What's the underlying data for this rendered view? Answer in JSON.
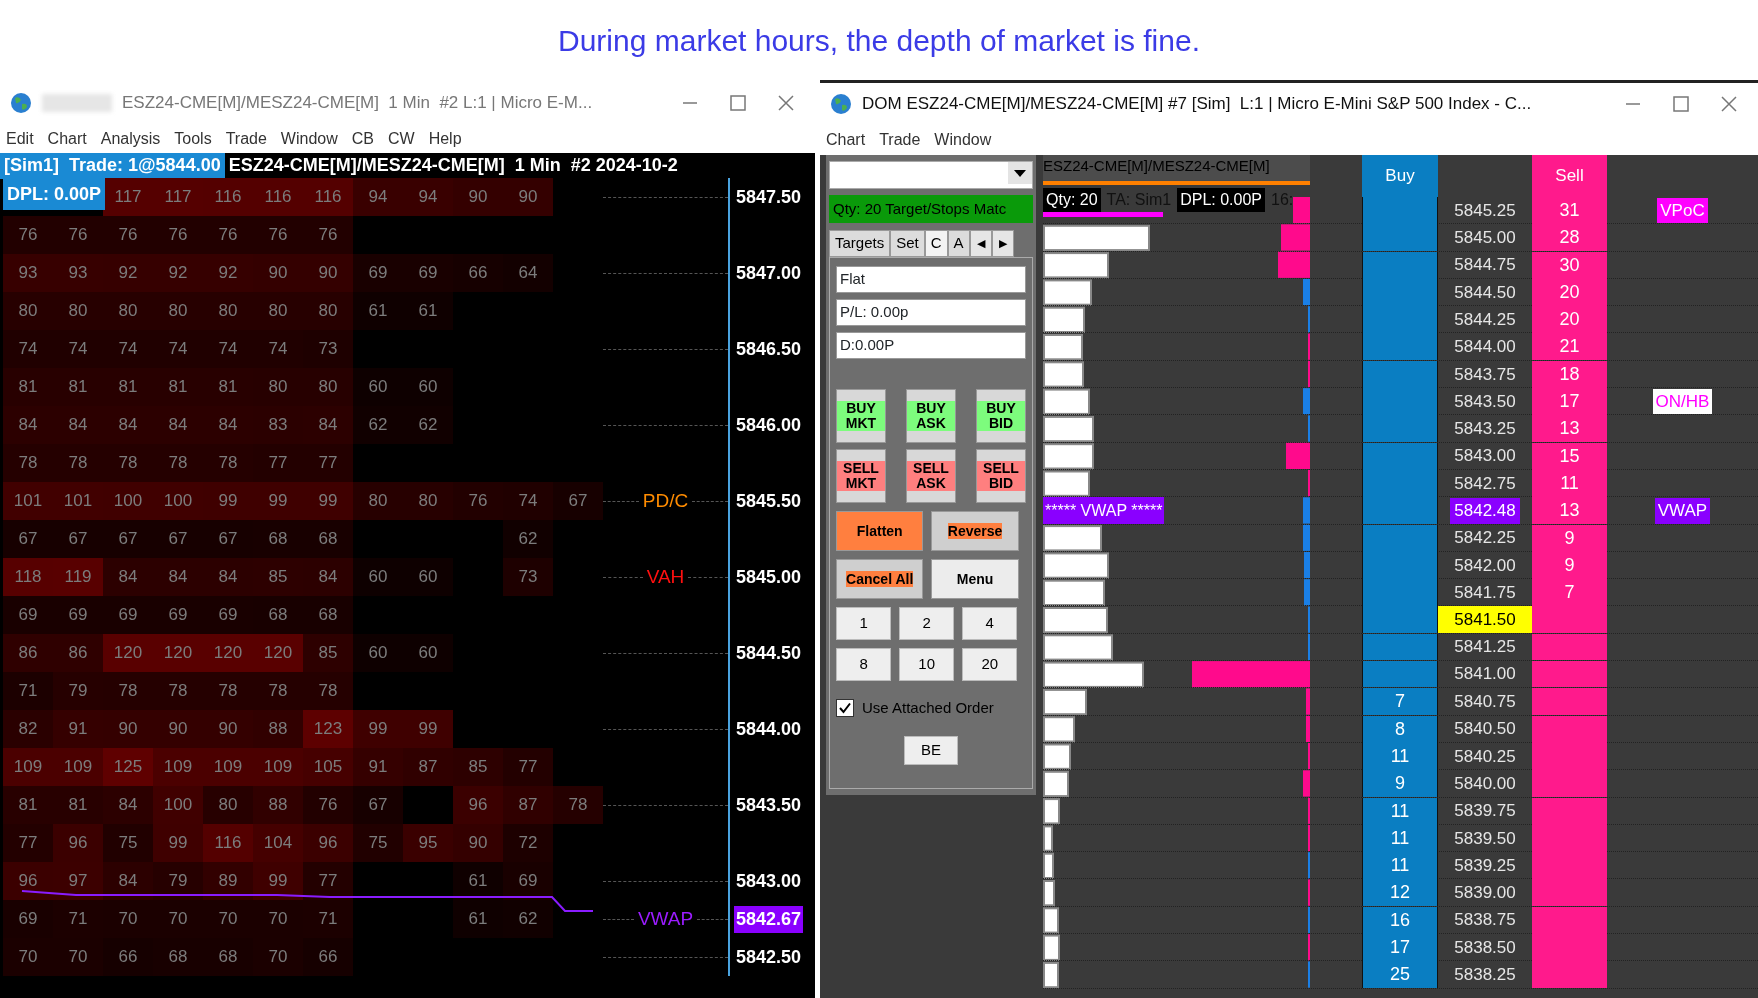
{
  "caption": "During market hours, the depth of market is fine.",
  "chart_window": {
    "title": "ESZ24-CME[M]/MESZ24-CME[M]  1 Min  #2 L:1 | Micro E-M...",
    "menu": [
      "Edit",
      "Chart",
      "Analysis",
      "Tools",
      "Trade",
      "Window",
      "CB",
      "CW",
      "Help"
    ],
    "header": {
      "account": "[Sim1]  Trade: 1@5844.00",
      "instrument": "ESZ24-CME[M]/MESZ24-CME[M]  1 Min  #2 2024-10-2",
      "dpl": "DPL: 0.00P"
    },
    "rows": [
      {
        "cells": [
          null,
          null,
          "117",
          "117",
          "116",
          "116",
          "116",
          "94",
          "94",
          "90",
          "90"
        ],
        "axis": {
          "text": "5847.50",
          "kind": "tick"
        }
      },
      {
        "cells": [
          "76",
          "76",
          "76",
          "76",
          "76",
          "76",
          "76"
        ]
      },
      {
        "cells": [
          "93",
          "93",
          "92",
          "92",
          "92",
          "90",
          "90",
          "69",
          "69",
          "66",
          "64"
        ],
        "axis": {
          "text": "5847.00",
          "kind": "tick"
        }
      },
      {
        "cells": [
          "80",
          "80",
          "80",
          "80",
          "80",
          "80",
          "80",
          "61",
          "61"
        ]
      },
      {
        "cells": [
          "74",
          "74",
          "74",
          "74",
          "74",
          "74",
          "73"
        ],
        "axis": {
          "text": "5846.50",
          "kind": "tick"
        }
      },
      {
        "cells": [
          "81",
          "81",
          "81",
          "81",
          "81",
          "80",
          "80",
          "60",
          "60"
        ]
      },
      {
        "cells": [
          "84",
          "84",
          "84",
          "84",
          "84",
          "83",
          "84",
          "62",
          "62"
        ],
        "axis": {
          "text": "5846.00",
          "kind": "tick"
        }
      },
      {
        "cells": [
          "78",
          "78",
          "78",
          "78",
          "78",
          "77",
          "77"
        ]
      },
      {
        "cells": [
          "101",
          "101",
          "100",
          "100",
          "99",
          "99",
          "99",
          "80",
          "80",
          "76",
          "74",
          "67"
        ],
        "axis": {
          "text": "5845.50",
          "kind": "tick"
        },
        "label": {
          "text": "PD/C",
          "color": "#ff8c00"
        }
      },
      {
        "cells": [
          "67",
          "67",
          "67",
          "67",
          "67",
          "68",
          "68",
          null,
          null,
          null,
          "62"
        ]
      },
      {
        "cells": [
          "118",
          "119",
          "84",
          "84",
          "84",
          "85",
          "84",
          "60",
          "60",
          null,
          "73"
        ],
        "axis": {
          "text": "5845.00",
          "kind": "tick"
        },
        "label": {
          "text": "VAH",
          "color": "#ff1010"
        }
      },
      {
        "cells": [
          "69",
          "69",
          "69",
          "69",
          "69",
          "68",
          "68"
        ]
      },
      {
        "cells": [
          "86",
          "86",
          "120",
          "120",
          "120",
          "120",
          "85",
          "60",
          "60"
        ],
        "axis": {
          "text": "5844.50",
          "kind": "tick"
        }
      },
      {
        "cells": [
          "71",
          "79",
          "78",
          "78",
          "78",
          "78",
          "78"
        ]
      },
      {
        "cells": [
          "82",
          "91",
          "90",
          "90",
          "90",
          "88",
          "123",
          "99",
          "99"
        ],
        "axis": {
          "text": "5844.00",
          "kind": "tick"
        }
      },
      {
        "cells": [
          "109",
          "109",
          "125",
          "109",
          "109",
          "109",
          "105",
          "91",
          "87",
          "85",
          "77"
        ]
      },
      {
        "cells": [
          "81",
          "81",
          "84",
          "100",
          "80",
          "88",
          "76",
          "67",
          null,
          "96",
          "87",
          "78"
        ],
        "axis": {
          "text": "5843.50",
          "kind": "tick"
        }
      },
      {
        "cells": [
          "77",
          "96",
          "75",
          "99",
          "116",
          "104",
          "96",
          "75",
          "95",
          "90",
          "72"
        ]
      },
      {
        "cells": [
          "96",
          "97",
          "84",
          "79",
          "89",
          "99",
          "77",
          null,
          null,
          "61",
          "69"
        ],
        "axis": {
          "text": "5843.00",
          "kind": "tick"
        }
      },
      {
        "cells": [
          "69",
          "71",
          "70",
          "70",
          "70",
          "70",
          "71",
          null,
          null,
          "61",
          "62"
        ],
        "axis": {
          "text": "5842.67",
          "kind": "vwap"
        },
        "label": {
          "text": "VWAP",
          "color": "#9b1cff"
        }
      },
      {
        "cells": [
          "70",
          "70",
          "66",
          "68",
          "68",
          "70",
          "66"
        ],
        "axis": {
          "text": "5842.50",
          "kind": "tick"
        }
      }
    ]
  },
  "dom_window": {
    "title": "DOM ESZ24-CME[M]/MESZ24-CME[M] #7 [Sim]  L:1 | Micro E-Mini S&P 500 Index - C...",
    "menu": [
      "Chart",
      "Trade",
      "Window"
    ],
    "panel": {
      "status": "Qty: 20 Target/Stops Matc",
      "tabs": [
        {
          "label": "Targets",
          "selected": false
        },
        {
          "label": "Set",
          "selected": false
        },
        {
          "label": "C",
          "selected": true
        },
        {
          "label": "A",
          "selected": false
        }
      ],
      "scroll": [
        "◀",
        "▶"
      ],
      "fields": [
        "Flat",
        "P/L: 0.00p",
        "D:0.00P"
      ],
      "order_buttons": [
        {
          "label": "BUY MKT",
          "kind": "buy"
        },
        {
          "label": "BUY ASK",
          "kind": "buy"
        },
        {
          "label": "BUY BID",
          "kind": "buy"
        },
        {
          "label": "SELL MKT",
          "kind": "sell"
        },
        {
          "label": "SELL ASK",
          "kind": "sell"
        },
        {
          "label": "SELL BID",
          "kind": "sell"
        }
      ],
      "action_buttons": [
        {
          "label": "Flatten",
          "kind": "filled"
        },
        {
          "label": "Reverse",
          "kind": "marked"
        },
        {
          "label": "Cancel All",
          "kind": "marked"
        },
        {
          "label": "Menu",
          "kind": "plain"
        }
      ],
      "quantities": [
        "1",
        "2",
        "4",
        "8",
        "10",
        "20"
      ],
      "attached": {
        "label": "Use Attached Order",
        "checked": true
      },
      "be": "BE"
    },
    "ladder": {
      "instrument": "ESZ24-CME[M]/MESZ24-CME[M]",
      "qty": "Qty: 20",
      "account": "TA: Sim1",
      "dpl": "DPL: 0.00P",
      "time": "16:",
      "buy_header": "Buy",
      "sell_header": "Sell",
      "rows": [
        {
          "price": "5845.25",
          "sell": "31",
          "kind": "level",
          "tag": {
            "text": "VPoC",
            "kind": "vpoc"
          }
        },
        {
          "price": "5845.00",
          "sell": "28",
          "kind": "level"
        },
        {
          "price": "5844.75",
          "sell": "30",
          "kind": "level"
        },
        {
          "price": "5844.50",
          "sell": "20",
          "kind": "level"
        },
        {
          "price": "5844.25",
          "sell": "20",
          "kind": "level"
        },
        {
          "price": "5844.00",
          "sell": "21",
          "kind": "level"
        },
        {
          "price": "5843.75",
          "sell": "18",
          "kind": "level"
        },
        {
          "price": "5843.50",
          "sell": "17",
          "kind": "level",
          "tag": {
            "text": "ON/HB",
            "kind": "onhb"
          }
        },
        {
          "price": "5843.25",
          "sell": "13",
          "kind": "level"
        },
        {
          "price": "5843.00",
          "sell": "15",
          "kind": "level"
        },
        {
          "price": "5842.75",
          "sell": "11",
          "kind": "level"
        },
        {
          "price": "5842.48",
          "sell": "13",
          "kind": "vwap",
          "profile_label": "***** VWAP *****",
          "tag": {
            "text": "VWAP",
            "kind": "vwap"
          }
        },
        {
          "price": "5842.25",
          "sell": "9",
          "kind": "level"
        },
        {
          "price": "5842.00",
          "sell": "9",
          "kind": "level"
        },
        {
          "price": "5841.75",
          "sell": "7",
          "kind": "level"
        },
        {
          "price": "5841.50",
          "kind": "last"
        },
        {
          "price": "5841.25",
          "kind": "level"
        },
        {
          "price": "5841.00",
          "kind": "level"
        },
        {
          "price": "5840.75",
          "buy": "7",
          "kind": "level"
        },
        {
          "price": "5840.50",
          "buy": "8",
          "kind": "level"
        },
        {
          "price": "5840.25",
          "buy": "11",
          "kind": "level"
        },
        {
          "price": "5840.00",
          "buy": "9",
          "kind": "level"
        },
        {
          "price": "5839.75",
          "buy": "11",
          "kind": "level"
        },
        {
          "price": "5839.50",
          "buy": "11",
          "kind": "level"
        },
        {
          "price": "5839.25",
          "buy": "11",
          "kind": "level"
        },
        {
          "price": "5839.00",
          "buy": "12",
          "kind": "level"
        },
        {
          "price": "5838.75",
          "buy": "16",
          "kind": "level"
        },
        {
          "price": "5838.50",
          "buy": "17",
          "kind": "level"
        },
        {
          "price": "5838.25",
          "buy": "25",
          "kind": "level"
        }
      ]
    }
  }
}
